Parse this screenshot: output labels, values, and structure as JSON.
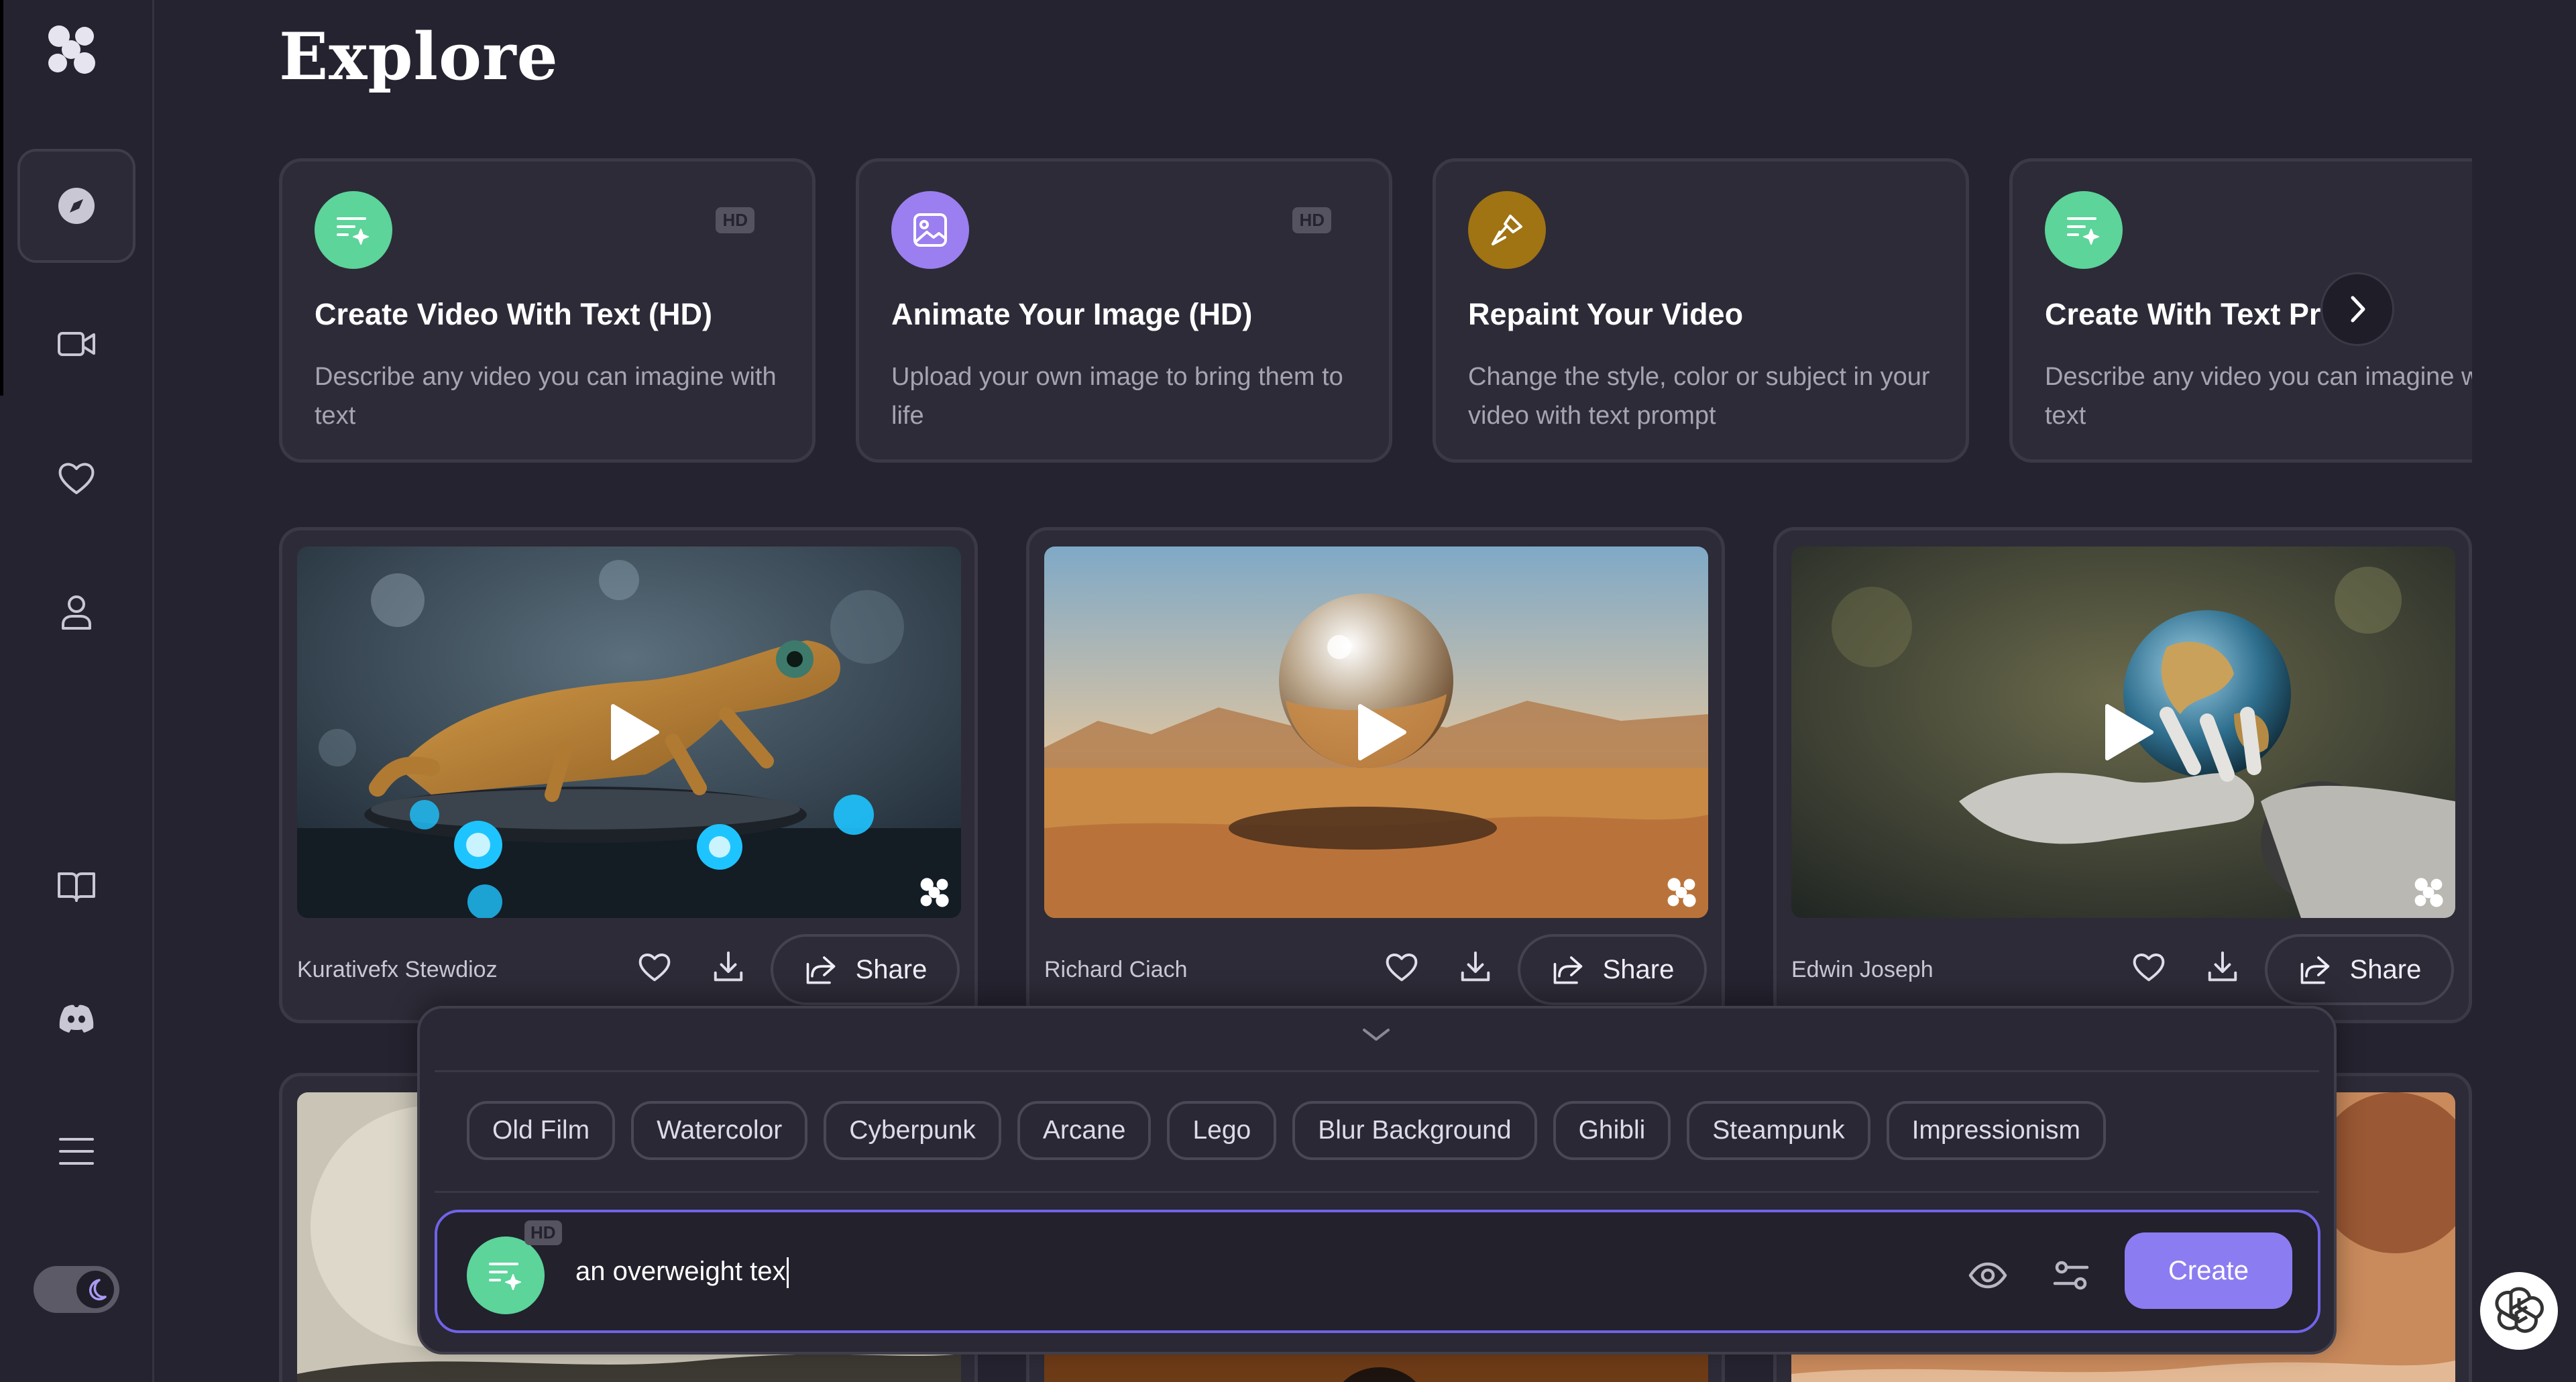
{
  "page": {
    "title": "Explore"
  },
  "sidebar": {
    "items": [
      {
        "name": "explore",
        "icon": "compass-icon",
        "active": true
      },
      {
        "name": "videos",
        "icon": "video-camera-icon"
      },
      {
        "name": "favorites",
        "icon": "heart-icon"
      },
      {
        "name": "profile",
        "icon": "user-icon"
      },
      {
        "name": "docs",
        "icon": "book-icon"
      },
      {
        "name": "discord",
        "icon": "discord-icon"
      },
      {
        "name": "menu",
        "icon": "menu-icon"
      }
    ],
    "theme_toggle": {
      "mode": "dark",
      "icon": "moon-icon"
    }
  },
  "features": [
    {
      "title": "Create Video With Text (HD)",
      "desc": "Describe any video you can imagine with text",
      "badge": "HD",
      "icon": "text-sparkle-icon",
      "color": "#5cd49a"
    },
    {
      "title": "Animate Your Image (HD)",
      "desc": "Upload your own image to bring them to life",
      "badge": "HD",
      "icon": "image-icon",
      "color": "#9b7ef0"
    },
    {
      "title": "Repaint Your Video",
      "desc": "Change the style, color or subject in your video with text prompt",
      "badge": "",
      "icon": "paint-brush-icon",
      "color": "#a07313"
    },
    {
      "title": "Create With Text Pro",
      "desc": "Describe any video you can imagine with text",
      "badge": "",
      "icon": "text-sparkle-icon",
      "color": "#5cd49a"
    }
  ],
  "videos": [
    {
      "author": "Kurativefx Stewdioz",
      "share_label": "Share"
    },
    {
      "author": "Richard Ciach",
      "share_label": "Share"
    },
    {
      "author": "Edwin Joseph",
      "share_label": "Share"
    }
  ],
  "prompt": {
    "styles": [
      "Old Film",
      "Watercolor",
      "Cyberpunk",
      "Arcane",
      "Lego",
      "Blur Background",
      "Ghibli",
      "Steampunk",
      "Impressionism"
    ],
    "badge": "HD",
    "value": "an overweight tex",
    "create_label": "Create"
  },
  "colors": {
    "accent": "#8c7cf2",
    "background": "#25232f",
    "card": "#2d2b37"
  }
}
